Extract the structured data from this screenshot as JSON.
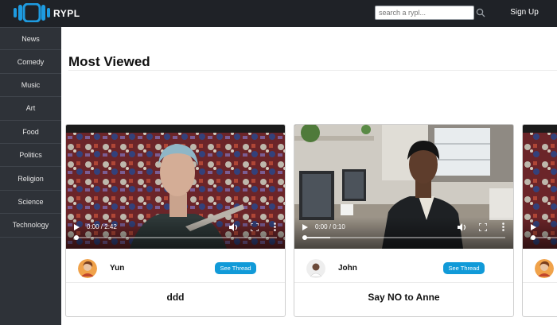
{
  "brand": {
    "name": "RYPL",
    "accent": "#119ad8"
  },
  "header": {
    "search_placeholder": "search a rypl...",
    "signup_label": "Sign Up"
  },
  "sidebar": {
    "items": [
      {
        "label": "News"
      },
      {
        "label": "Comedy"
      },
      {
        "label": "Music"
      },
      {
        "label": "Art"
      },
      {
        "label": "Food"
      },
      {
        "label": "Politics"
      },
      {
        "label": "Religion"
      },
      {
        "label": "Science"
      },
      {
        "label": "Technology"
      }
    ]
  },
  "main": {
    "section_title": "Most Viewed"
  },
  "cards": [
    {
      "time": "0:00 / 2:42",
      "user": "Yun",
      "thread_label": "See Thread",
      "title": "ddd"
    },
    {
      "time": "0:00 / 0:10",
      "user": "John",
      "thread_label": "See Thread",
      "title": "Say NO to Anne"
    }
  ]
}
